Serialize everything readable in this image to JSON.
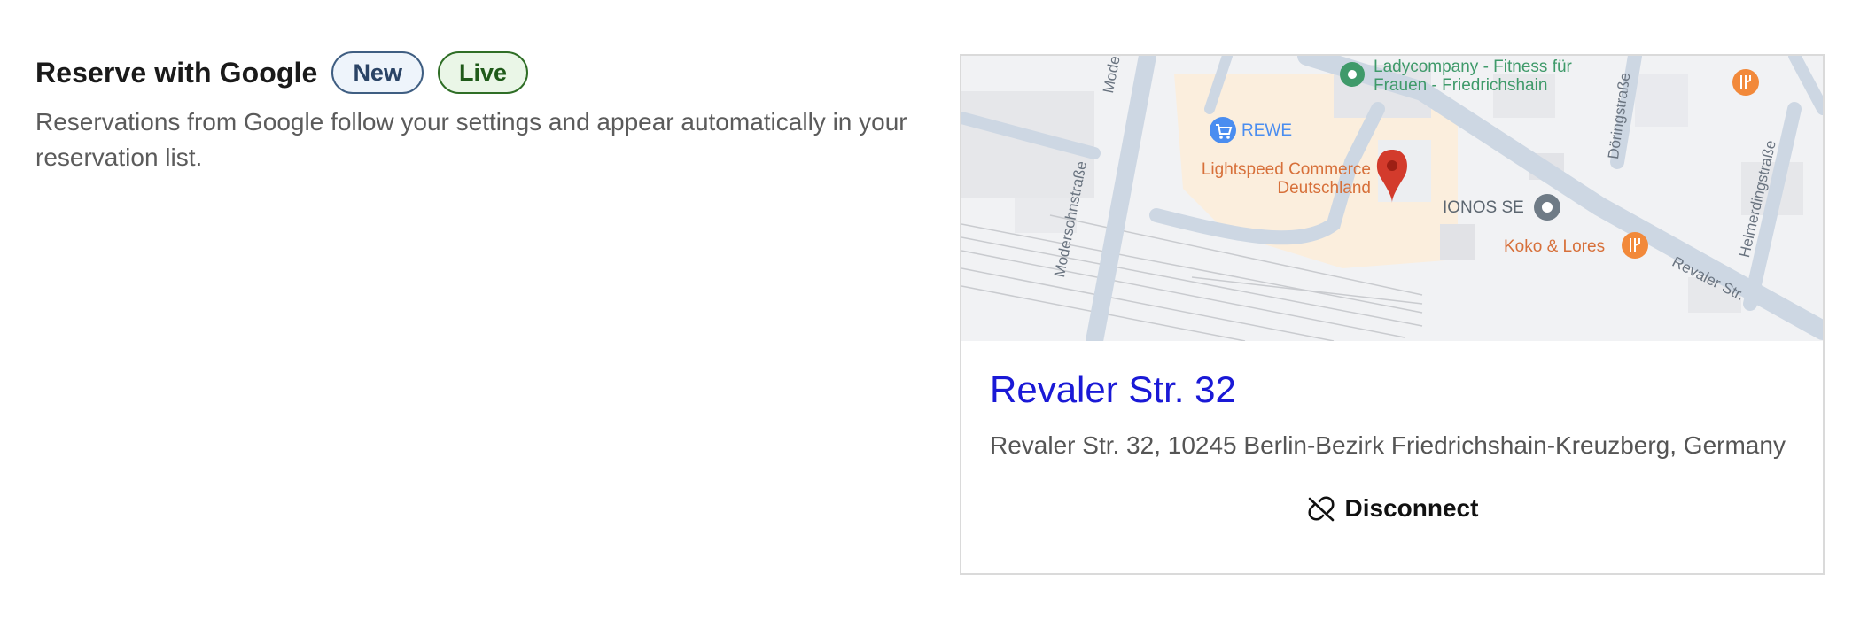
{
  "section": {
    "title": "Reserve with Google",
    "badges": {
      "new": "New",
      "live": "Live"
    },
    "description": "Reservations from Google follow your settings and appear automatically in your reservation list."
  },
  "location_card": {
    "map": {
      "labels": {
        "ladycompany_line1": "Ladycompany - Fitness für",
        "ladycompany_line2": "Frauen - Friedrichshain",
        "rewe": "REWE",
        "lightspeed_line1": "Lightspeed Commerce",
        "lightspeed_line2": "Deutschland",
        "ionos": "IONOS SE",
        "koko": "Koko & Lores",
        "modersohnstrasse_top": "Modersohnstraße",
        "modersohnstrasse_bottom": "Modersohnstraße",
        "doeringstrasse": "Döringstraße",
        "helmerdingstrasse": "Helmerdingstraße",
        "revaler_str": "Revaler Str."
      },
      "colors": {
        "pin": "#d33b2c",
        "poi_green": "#3f9a6a",
        "poi_blue": "#4a8df0",
        "poi_gray": "#6f7b86",
        "poi_orange": "#f2893a",
        "commercial_label": "#d7703a"
      }
    },
    "place_name": "Revaler Str. 32",
    "address": "Revaler Str. 32, 10245 Berlin-Bezirk Friedrichshain-Kreuzberg, Germany",
    "disconnect_label": "Disconnect"
  }
}
